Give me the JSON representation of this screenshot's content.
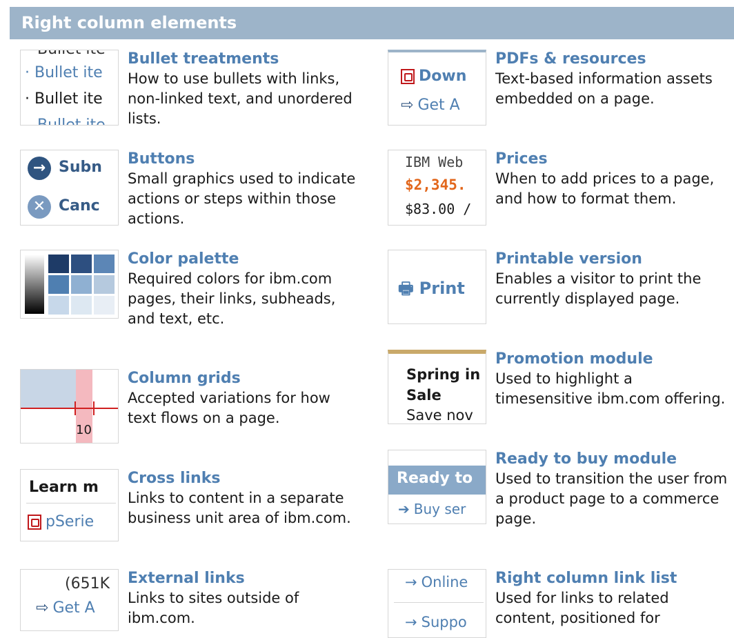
{
  "header": {
    "title": "Right column elements"
  },
  "left": [
    {
      "title": "Bullet treatments",
      "desc": "How to use bullets with links, non-linked text, and unordered lists.",
      "thumb": {
        "lines": [
          "Bullet ite",
          "· Bullet ite",
          "· Bullet ite",
          "Bullet ite"
        ]
      }
    },
    {
      "title": "Buttons",
      "desc": "Small graphics used to indicate actions or steps within those actions.",
      "thumb": {
        "submit": "Subn",
        "cancel": "Canc"
      }
    },
    {
      "title": "Color palette",
      "desc": "Required colors for ibm.com pages, their links, subheads, and text, etc."
    },
    {
      "title": "Column grids",
      "desc": "Accepted variations for how text flows on a page.",
      "thumb": {
        "number": "10"
      }
    },
    {
      "title": "Cross links",
      "desc": "Links to content in a separate business unit area of ibm.com.",
      "thumb": {
        "heading": "Learn m",
        "link": "pSerie"
      }
    },
    {
      "title": "External links",
      "desc": "Links to sites outside of ibm.com.",
      "thumb": {
        "size": "(651K",
        "link": "Get A"
      }
    }
  ],
  "right": [
    {
      "title": "PDFs & resources",
      "desc": "Text-based information assets embedded on a page.",
      "thumb": {
        "download": "Down",
        "get": "Get A"
      }
    },
    {
      "title": "Prices",
      "desc": "When to add prices to a page, and how to format them.",
      "thumb": {
        "product": "IBM Web",
        "price": "$2,345.",
        "monthly": "$83.00 /"
      }
    },
    {
      "title": "Printable version",
      "desc": "Enables a visitor to print the currently displayed page.",
      "thumb": {
        "print": "Print"
      }
    },
    {
      "title": "Promotion module",
      "desc": "Used to highlight a timesensitive ibm.com offering.",
      "thumb": {
        "line1": "Spring in",
        "line2": "Sale",
        "line3": "Save nov"
      }
    },
    {
      "title": "Ready to buy module",
      "desc": "Used to transition the user from a product page to a commerce page.",
      "thumb": {
        "banner": "Ready to",
        "link": "Buy ser"
      }
    },
    {
      "title": "Right column link list",
      "desc": "Used for links to related content, positioned for",
      "thumb": {
        "link1": "Online",
        "link2": "Suppo"
      }
    }
  ],
  "colors": {
    "header": "#9db4c9",
    "link": "#4f7fb1",
    "price": "#e2661b",
    "accent": "#365b86"
  }
}
